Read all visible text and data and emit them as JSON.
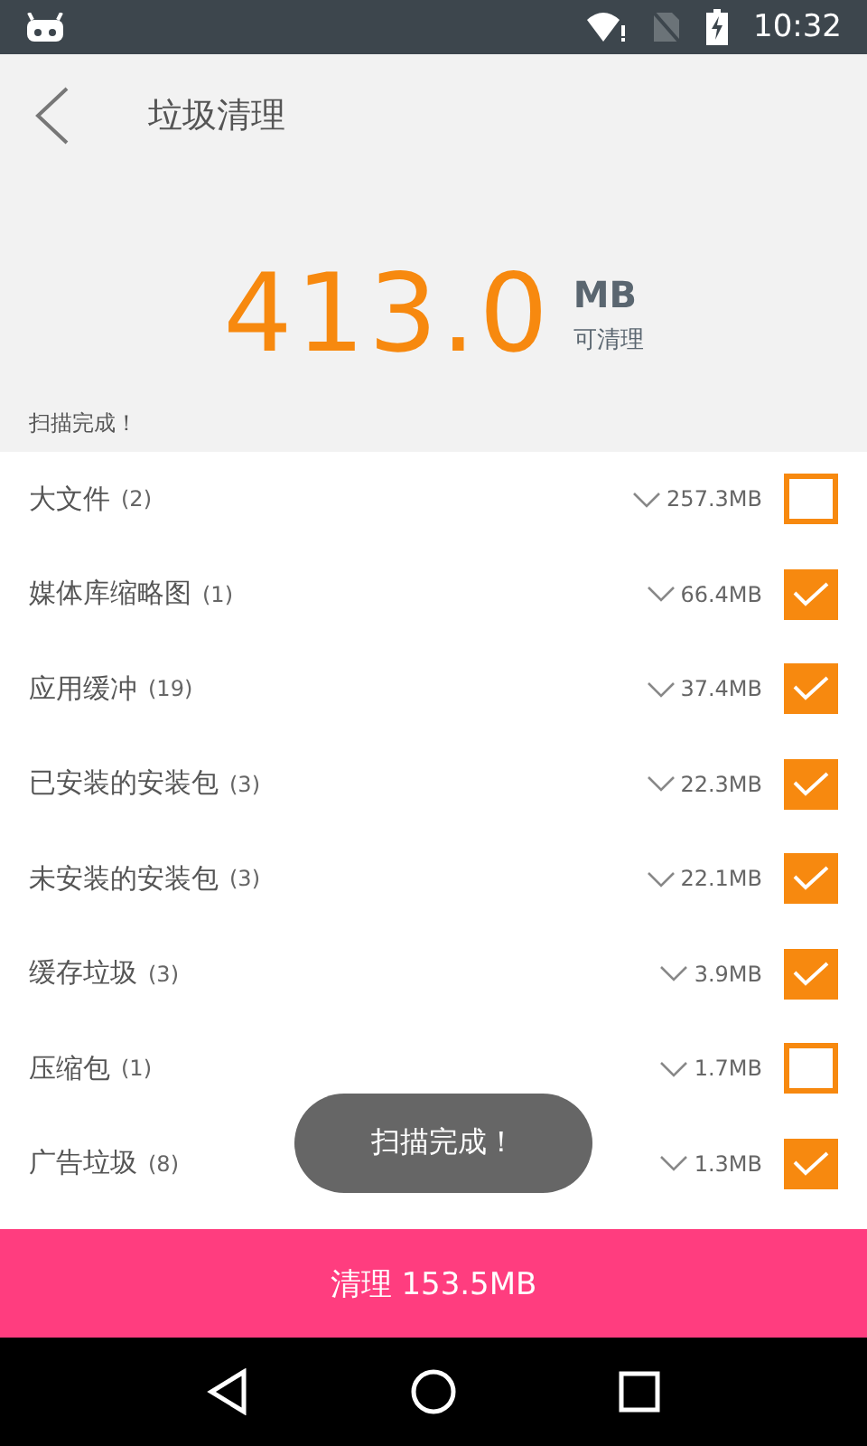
{
  "status_bar": {
    "time": "10:32"
  },
  "header": {
    "title": "垃圾清理"
  },
  "summary": {
    "amount": "413.0",
    "unit": "MB",
    "caption": "可清理",
    "status": "扫描完成！"
  },
  "items": [
    {
      "name": "大文件",
      "count": "(2)",
      "size": "257.3MB",
      "checked": false
    },
    {
      "name": "媒体库缩略图",
      "count": "(1)",
      "size": "66.4MB",
      "checked": true
    },
    {
      "name": "应用缓冲",
      "count": "(19)",
      "size": "37.4MB",
      "checked": true
    },
    {
      "name": "已安装的安装包",
      "count": "(3)",
      "size": "22.3MB",
      "checked": true
    },
    {
      "name": "未安装的安装包",
      "count": "(3)",
      "size": "22.1MB",
      "checked": true
    },
    {
      "name": "缓存垃圾",
      "count": "(3)",
      "size": "3.9MB",
      "checked": true
    },
    {
      "name": "压缩包",
      "count": "(1)",
      "size": "1.7MB",
      "checked": false
    },
    {
      "name": "广告垃圾",
      "count": "(8)",
      "size": "1.3MB",
      "checked": true
    }
  ],
  "toast": "扫描完成！",
  "clean_button": "清理 153.5MB"
}
